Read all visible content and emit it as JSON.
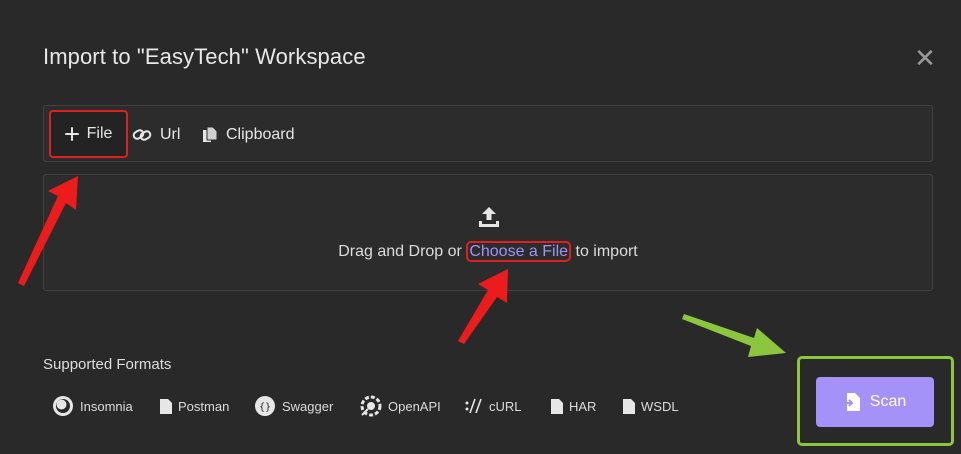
{
  "dialog": {
    "title": "Import to \"EasyTech\" Workspace",
    "close_icon": "close-icon"
  },
  "tabs": [
    {
      "label": "File",
      "icon": "plus-icon"
    },
    {
      "label": "Url",
      "icon": "link-icon"
    },
    {
      "label": "Clipboard",
      "icon": "clipboard-icon"
    }
  ],
  "dropzone": {
    "icon": "upload-icon",
    "text_before": "Drag and Drop or",
    "link": "Choose a File",
    "text_after": "to import"
  },
  "supported": {
    "label": "Supported Formats",
    "items": [
      {
        "label": "Insomnia",
        "icon": "insomnia-icon"
      },
      {
        "label": "Postman",
        "icon": "file-icon"
      },
      {
        "label": "Swagger",
        "icon": "swagger-icon"
      },
      {
        "label": "OpenAPI",
        "icon": "openapi-icon"
      },
      {
        "label": "cURL",
        "icon": "curl-icon"
      },
      {
        "label": "HAR",
        "icon": "file-icon"
      },
      {
        "label": "WSDL",
        "icon": "file-icon"
      }
    ]
  },
  "actions": {
    "scan_label": "Scan",
    "scan_icon": "file-import-icon"
  },
  "colors": {
    "accent": "#a492f8",
    "highlight_red": "#e02020",
    "highlight_green": "#8cc63f",
    "background": "#292929"
  }
}
